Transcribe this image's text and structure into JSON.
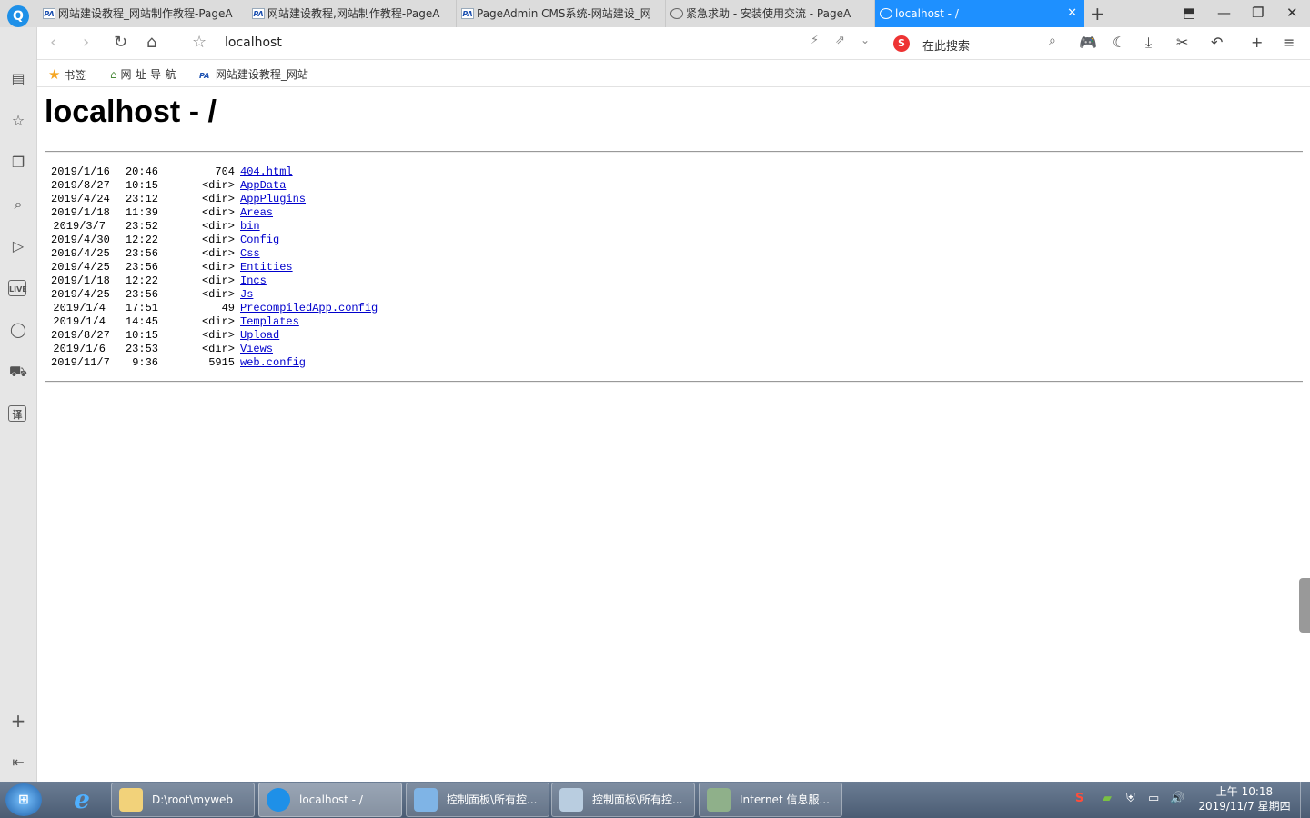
{
  "browser": {
    "tabs": [
      {
        "title": "网站建设教程_网站制作教程-PageA",
        "icon": "PA"
      },
      {
        "title": "网站建设教程,网站制作教程-PageA",
        "icon": "PA"
      },
      {
        "title": "PageAdmin CMS系统-网站建设_网",
        "icon": "PA"
      },
      {
        "title": "紧急求助 - 安装使用交流 - PageA",
        "icon": "globe"
      },
      {
        "title": "localhost - /",
        "icon": "globe"
      }
    ],
    "address": "localhost",
    "search_placeholder": "在此搜索",
    "bookmarks": [
      {
        "label": "书签",
        "icon": "star-icon"
      },
      {
        "label": "网-址-导-航",
        "icon": "home-icon"
      },
      {
        "label": "网站建设教程_网站",
        "icon": "PA"
      }
    ],
    "sidebar_icons": [
      "news-icon",
      "favorites-icon",
      "reader-icon",
      "search-icon",
      "video-icon",
      "live-icon",
      "chat-icon",
      "cart-icon",
      "translate-icon",
      "add-icon",
      "collapse-icon"
    ],
    "accent_color": "#1e90ff"
  },
  "page": {
    "heading": "localhost - /",
    "entries": [
      {
        "date": "2019/1/16",
        "time": "20:46",
        "size": "704",
        "name": "404.html"
      },
      {
        "date": "2019/8/27",
        "time": "10:15",
        "size": "<dir>",
        "name": "AppData"
      },
      {
        "date": "2019/4/24",
        "time": "23:12",
        "size": "<dir>",
        "name": "AppPlugins"
      },
      {
        "date": "2019/1/18",
        "time": "11:39",
        "size": "<dir>",
        "name": "Areas"
      },
      {
        "date": "2019/3/7",
        "time": "23:52",
        "size": "<dir>",
        "name": "bin"
      },
      {
        "date": "2019/4/30",
        "time": "12:22",
        "size": "<dir>",
        "name": "Config"
      },
      {
        "date": "2019/4/25",
        "time": "23:56",
        "size": "<dir>",
        "name": "Css"
      },
      {
        "date": "2019/4/25",
        "time": "23:56",
        "size": "<dir>",
        "name": "Entities"
      },
      {
        "date": "2019/1/18",
        "time": "12:22",
        "size": "<dir>",
        "name": "Incs"
      },
      {
        "date": "2019/4/25",
        "time": "23:56",
        "size": "<dir>",
        "name": "Js"
      },
      {
        "date": "2019/1/4",
        "time": "17:51",
        "size": "49",
        "name": "PrecompiledApp.config"
      },
      {
        "date": "2019/1/4",
        "time": "14:45",
        "size": "<dir>",
        "name": "Templates"
      },
      {
        "date": "2019/8/27",
        "time": "10:15",
        "size": "<dir>",
        "name": "Upload"
      },
      {
        "date": "2019/1/6",
        "time": "23:53",
        "size": "<dir>",
        "name": "Views"
      },
      {
        "date": "2019/11/7",
        "time": "9:36",
        "size": "5915",
        "name": "web.config"
      }
    ]
  },
  "taskbar": {
    "start_label": "⊞",
    "items": [
      {
        "label": "D:\\root\\myweb",
        "icon": "folder-icon"
      },
      {
        "label": "localhost - /",
        "icon": "browser-icon"
      },
      {
        "label": "控制面板\\所有控...",
        "icon": "control-panel-icon"
      },
      {
        "label": "控制面板\\所有控...",
        "icon": "control-panel-icon"
      },
      {
        "label": "Internet 信息服...",
        "icon": "iis-icon"
      }
    ],
    "clock_time": "上午 10:18",
    "clock_date": "2019/11/7 星期四"
  }
}
